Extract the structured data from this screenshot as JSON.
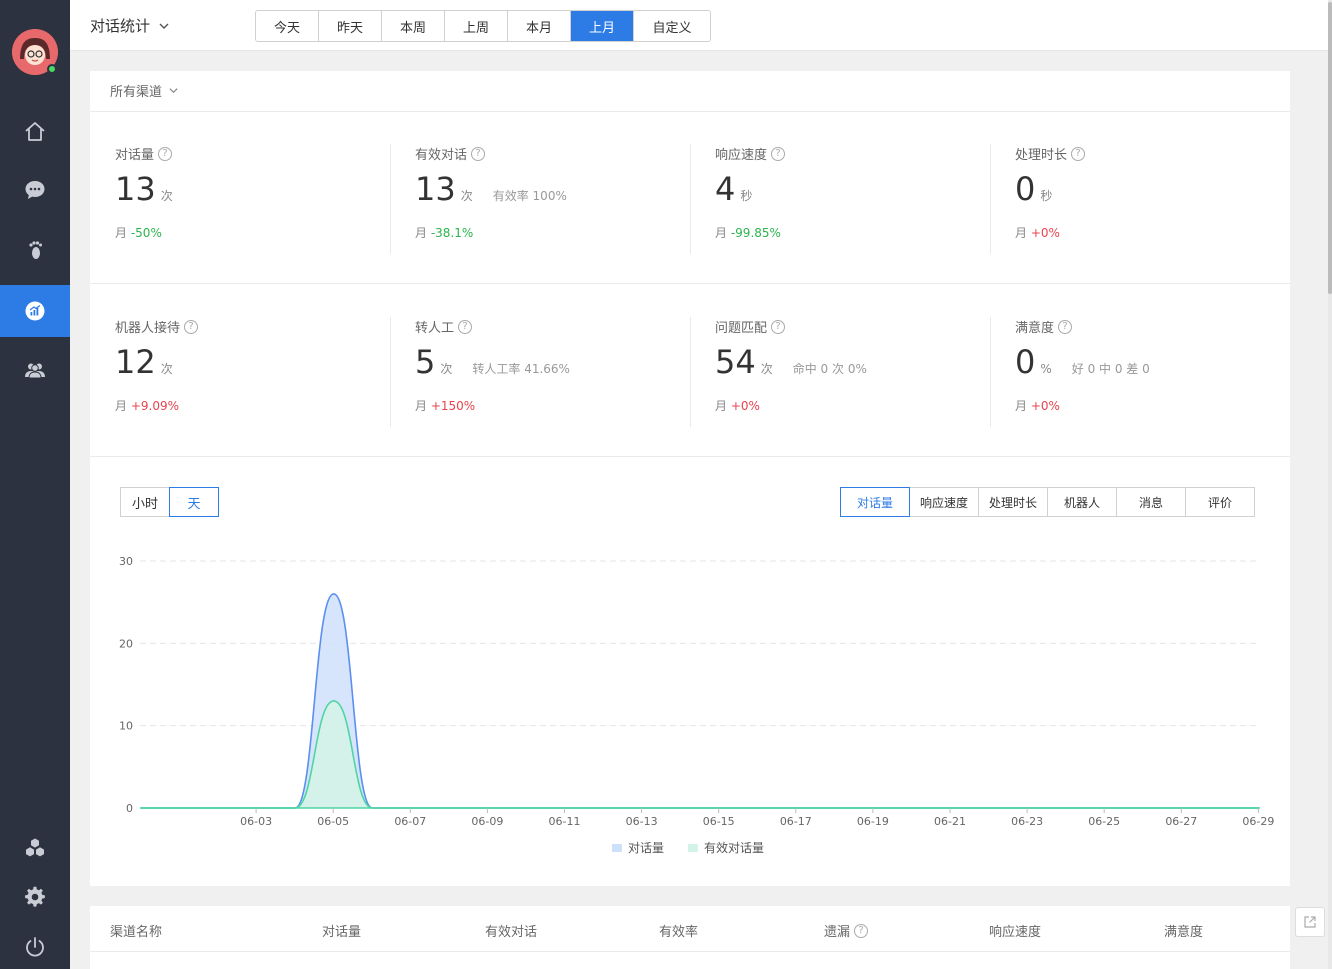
{
  "sidebar": {
    "items": [
      {
        "icon": "home-icon"
      },
      {
        "icon": "chat-icon"
      },
      {
        "icon": "footprint-icon"
      },
      {
        "icon": "statistics-icon",
        "active": true
      },
      {
        "icon": "users-icon"
      },
      {
        "icon": "apps-icon"
      },
      {
        "icon": "settings-icon"
      },
      {
        "icon": "power-icon"
      }
    ]
  },
  "header": {
    "title": "对话统计",
    "date_tabs": [
      "今天",
      "昨天",
      "本周",
      "上周",
      "本月",
      "上月",
      "自定义"
    ],
    "active_date_tab": "上月"
  },
  "filter": {
    "channel": "所有渠道"
  },
  "stats": [
    {
      "label": "对话量",
      "value": "13",
      "unit": "次",
      "extra": "",
      "trend_prefix": "月",
      "trend": "-50%",
      "trend_dir": "down"
    },
    {
      "label": "有效对话",
      "value": "13",
      "unit": "次",
      "extra": "有效率 100%",
      "trend_prefix": "月",
      "trend": "-38.1%",
      "trend_dir": "down"
    },
    {
      "label": "响应速度",
      "value": "4",
      "unit": "秒",
      "extra": "",
      "trend_prefix": "月",
      "trend": "-99.85%",
      "trend_dir": "down"
    },
    {
      "label": "处理时长",
      "value": "0",
      "unit": "秒",
      "extra": "",
      "trend_prefix": "月",
      "trend": "+0%",
      "trend_dir": "up"
    },
    {
      "label": "机器人接待",
      "value": "12",
      "unit": "次",
      "extra": "",
      "trend_prefix": "月",
      "trend": "+9.09%",
      "trend_dir": "up"
    },
    {
      "label": "转人工",
      "value": "5",
      "unit": "次",
      "extra": "转人工率 41.66%",
      "trend_prefix": "月",
      "trend": "+150%",
      "trend_dir": "up"
    },
    {
      "label": "问题匹配",
      "value": "54",
      "unit": "次",
      "extra": "命中 0 次 0%",
      "trend_prefix": "月",
      "trend": "+0%",
      "trend_dir": "up"
    },
    {
      "label": "满意度",
      "value": "0",
      "unit": "%",
      "extra": "好 0 中 0 差 0",
      "trend_prefix": "月",
      "trend": "+0%",
      "trend_dir": "up"
    }
  ],
  "granularity_tabs": [
    "小时",
    "天"
  ],
  "active_granularity": "天",
  "metric_tabs": [
    "对话量",
    "响应速度",
    "处理时长",
    "机器人",
    "消息",
    "评价"
  ],
  "active_metric": "对话量",
  "colors": {
    "accent": "#2d7be5",
    "series_1": "#5b8ff0",
    "series_1_fill": "#cfe0fb",
    "series_2": "#4fd5a2",
    "series_2_fill": "#d3f3e6",
    "trend_down": "#2cb34d",
    "trend_up": "#e8434d"
  },
  "chart_data": {
    "type": "area",
    "x": [
      "06-01",
      "06-02",
      "06-03",
      "06-04",
      "06-05",
      "06-06",
      "06-07",
      "06-08",
      "06-09",
      "06-10",
      "06-11",
      "06-12",
      "06-13",
      "06-14",
      "06-15",
      "06-16",
      "06-17",
      "06-18",
      "06-19",
      "06-20",
      "06-21",
      "06-22",
      "06-23",
      "06-24",
      "06-25",
      "06-26",
      "06-27",
      "06-28",
      "06-29",
      "06-30"
    ],
    "tick_labels": [
      "06-03",
      "06-05",
      "06-07",
      "06-09",
      "06-11",
      "06-13",
      "06-15",
      "06-17",
      "06-19",
      "06-21",
      "06-23",
      "06-25",
      "06-27",
      "06-29"
    ],
    "series": [
      {
        "name": "对话量",
        "values": [
          0,
          0,
          0,
          0,
          0,
          26,
          0,
          0,
          0,
          0,
          0,
          0,
          0,
          0,
          0,
          0,
          0,
          0,
          0,
          0,
          0,
          0,
          0,
          0,
          0,
          0,
          0,
          0,
          0,
          0
        ]
      },
      {
        "name": "有效对话量",
        "values": [
          0,
          0,
          0,
          0,
          0,
          13,
          0,
          0,
          0,
          0,
          0,
          0,
          0,
          0,
          0,
          0,
          0,
          0,
          0,
          0,
          0,
          0,
          0,
          0,
          0,
          0,
          0,
          0,
          0,
          0
        ]
      }
    ],
    "ylim": [
      0,
      30
    ],
    "yticks": [
      0,
      10,
      20,
      30
    ],
    "grid": true,
    "legend": "bottom"
  },
  "table": {
    "headers": [
      {
        "label": "渠道名称",
        "help": false
      },
      {
        "label": "对话量",
        "help": false
      },
      {
        "label": "有效对话",
        "help": false
      },
      {
        "label": "有效率",
        "help": false
      },
      {
        "label": "遗漏",
        "help": true
      },
      {
        "label": "响应速度",
        "help": false
      },
      {
        "label": "满意度",
        "help": false
      }
    ]
  }
}
